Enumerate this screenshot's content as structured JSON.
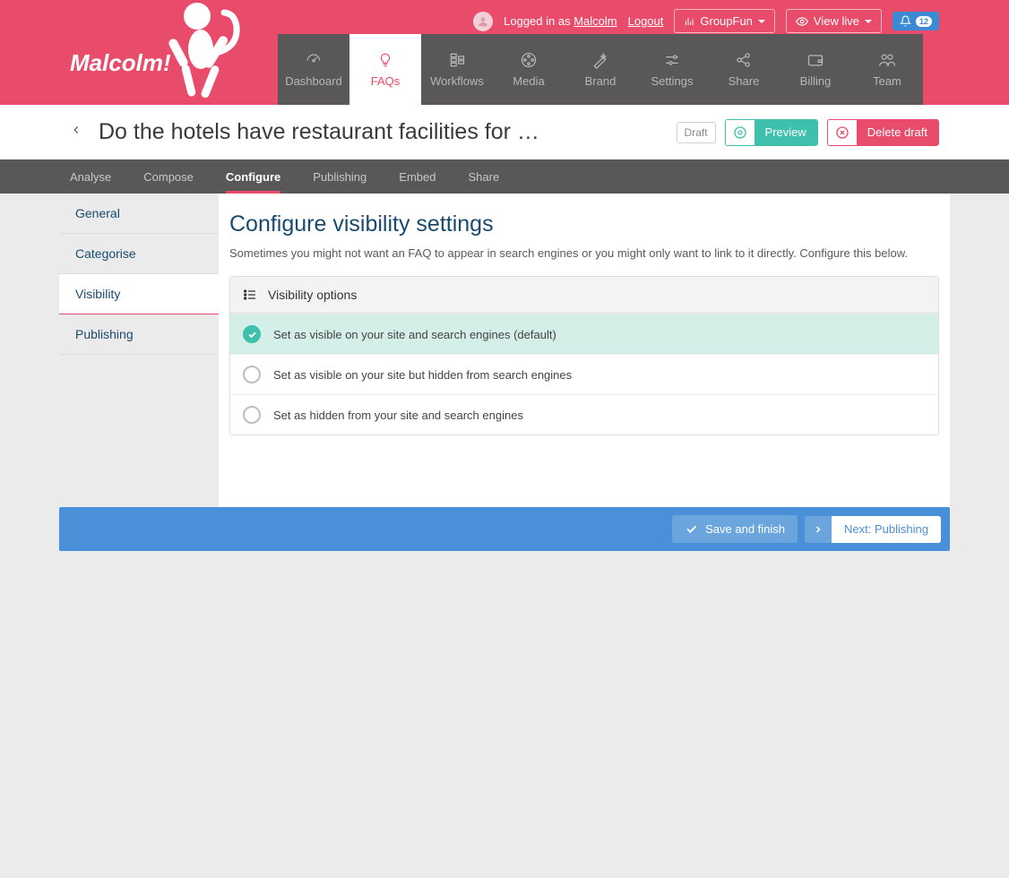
{
  "brand": "Malcolm!",
  "header": {
    "logged_in_as_prefix": "Logged in as",
    "user": "Malcolm",
    "logout": "Logout",
    "org": "GroupFun",
    "view_live": "View live",
    "notif_count": "12"
  },
  "nav": [
    {
      "label": "Dashboard"
    },
    {
      "label": "FAQs"
    },
    {
      "label": "Workflows"
    },
    {
      "label": "Media"
    },
    {
      "label": "Brand"
    },
    {
      "label": "Settings"
    },
    {
      "label": "Share"
    },
    {
      "label": "Billing"
    },
    {
      "label": "Team"
    }
  ],
  "page": {
    "title": "Do the hotels have restaurant facilities for …",
    "draft_badge": "Draft",
    "preview": "Preview",
    "delete": "Delete draft"
  },
  "subtabs": [
    "Analyse",
    "Compose",
    "Configure",
    "Publishing",
    "Embed",
    "Share"
  ],
  "sidebar": [
    "General",
    "Categorise",
    "Visibility",
    "Publishing"
  ],
  "panel": {
    "title": "Configure visibility settings",
    "desc": "Sometimes you might not want an FAQ to appear in search engines or you might only want to link to it directly. Configure this below.",
    "options_header": "Visibility options",
    "options": [
      "Set as visible on your site and search engines (default)",
      "Set as visible on your site but hidden from search engines",
      "Set as hidden from your site and search engines"
    ]
  },
  "footer": {
    "save": "Save and finish",
    "next": "Next: Publishing"
  }
}
